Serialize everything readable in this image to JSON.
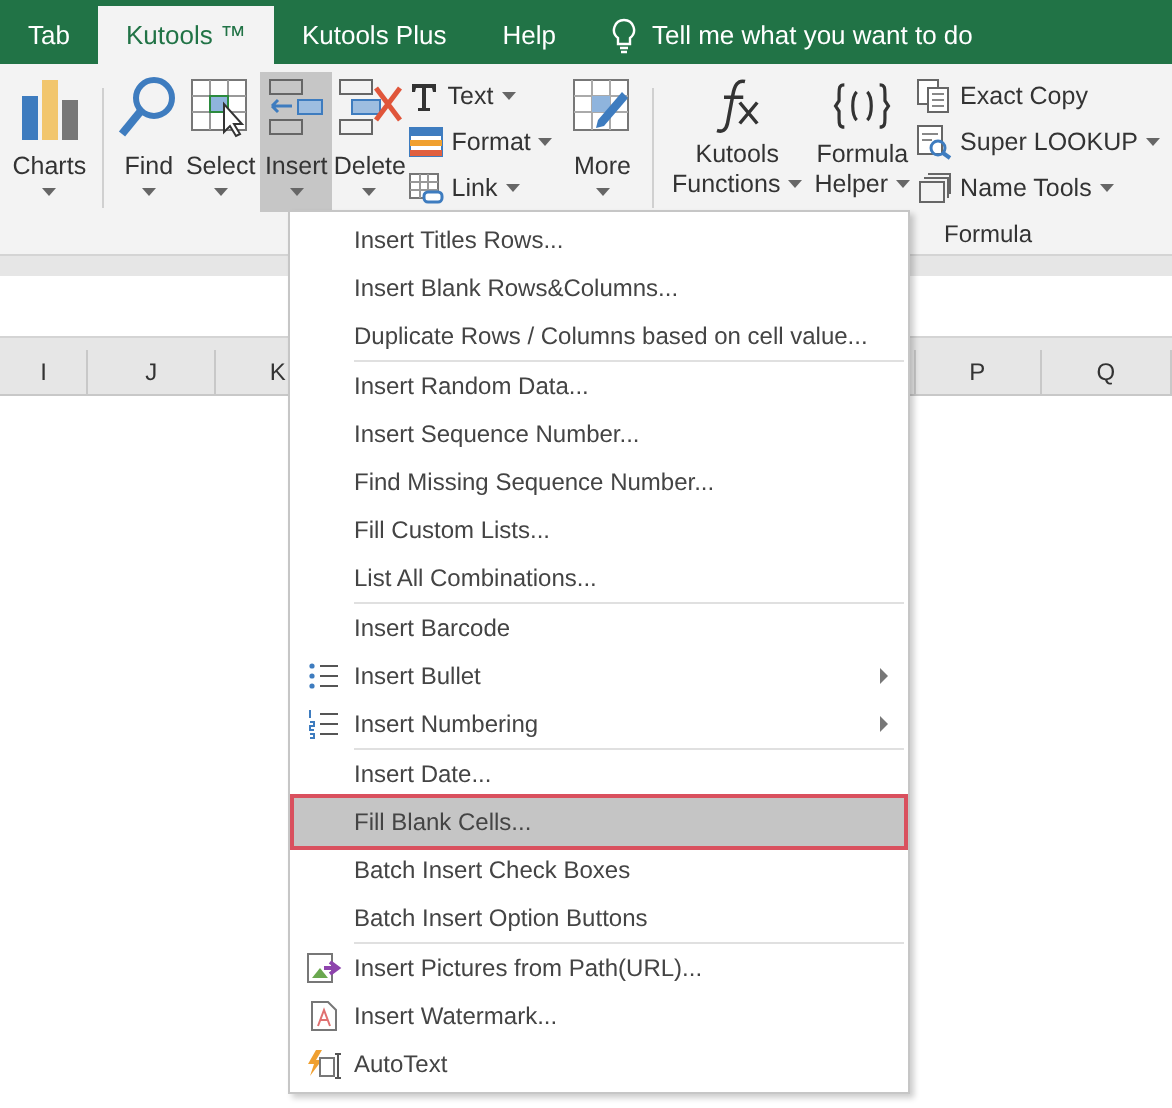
{
  "tabs": [
    {
      "label": "Tab",
      "selected": false
    },
    {
      "label": "Kutools ™",
      "selected": true
    },
    {
      "label": "Kutools Plus",
      "selected": false
    },
    {
      "label": "Help",
      "selected": false
    }
  ],
  "tell_me": "Tell me what you want to do",
  "ribbon": {
    "left_buttons": [
      {
        "kind": "charts",
        "label": "Charts",
        "selected": false
      },
      {
        "kind": "find",
        "label": "Find",
        "selected": false
      },
      {
        "kind": "select",
        "label": "Select",
        "selected": false
      },
      {
        "kind": "insert",
        "label": "Insert",
        "selected": true
      },
      {
        "kind": "delete",
        "label": "Delete",
        "selected": false
      }
    ],
    "small_left": [
      {
        "kind": "text",
        "label": "Text"
      },
      {
        "kind": "format",
        "label": "Format"
      },
      {
        "kind": "link",
        "label": "Link"
      }
    ],
    "more": {
      "label": "More",
      "selected": false
    },
    "formula_buttons": [
      {
        "kind": "fx",
        "line1": "Kutools",
        "line2": "Functions"
      },
      {
        "kind": "braces",
        "line1": "Formula",
        "line2": "Helper"
      }
    ],
    "small_right": [
      {
        "kind": "copy",
        "label": "Exact Copy",
        "caret": false
      },
      {
        "kind": "lookup",
        "label": "Super LOOKUP",
        "caret": true
      },
      {
        "kind": "names",
        "label": "Name Tools",
        "caret": true
      }
    ],
    "group_label": "Formula"
  },
  "columns_left": [
    "I",
    "J",
    "K"
  ],
  "columns_right": [
    "P",
    "Q"
  ],
  "menu": [
    [
      {
        "kind": "plain",
        "label": "Insert Titles Rows...",
        "selected": false,
        "submenu": false
      },
      {
        "kind": "plain",
        "label": "Insert Blank Rows&Columns...",
        "selected": false,
        "submenu": false
      },
      {
        "kind": "plain",
        "label": "Duplicate Rows / Columns based on cell value...",
        "selected": false,
        "submenu": false
      }
    ],
    [
      {
        "kind": "plain",
        "label": "Insert Random Data...",
        "selected": false,
        "submenu": false
      },
      {
        "kind": "plain",
        "label": "Insert Sequence Number...",
        "selected": false,
        "submenu": false
      },
      {
        "kind": "plain",
        "label": "Find Missing Sequence Number...",
        "selected": false,
        "submenu": false
      },
      {
        "kind": "plain",
        "label": "Fill Custom Lists...",
        "selected": false,
        "submenu": false
      },
      {
        "kind": "plain",
        "label": "List All Combinations...",
        "selected": false,
        "submenu": false
      }
    ],
    [
      {
        "kind": "plain",
        "label": "Insert Barcode",
        "selected": false,
        "submenu": false
      },
      {
        "kind": "bullet",
        "label": "Insert Bullet",
        "selected": false,
        "submenu": true
      },
      {
        "kind": "numbering",
        "label": "Insert Numbering",
        "selected": false,
        "submenu": true
      }
    ],
    [
      {
        "kind": "plain",
        "label": "Insert Date...",
        "selected": false,
        "submenu": false
      },
      {
        "kind": "plain",
        "label": "Fill Blank Cells...",
        "selected": true,
        "submenu": false
      },
      {
        "kind": "plain",
        "label": "Batch Insert Check Boxes",
        "selected": false,
        "submenu": false
      },
      {
        "kind": "plain",
        "label": "Batch Insert Option Buttons",
        "selected": false,
        "submenu": false
      }
    ],
    [
      {
        "kind": "picture",
        "label": "Insert Pictures from Path(URL)...",
        "selected": false,
        "submenu": false
      },
      {
        "kind": "watermark",
        "label": "Insert Watermark...",
        "selected": false,
        "submenu": false
      },
      {
        "kind": "autotext",
        "label": "AutoText",
        "selected": false,
        "submenu": false
      }
    ]
  ]
}
